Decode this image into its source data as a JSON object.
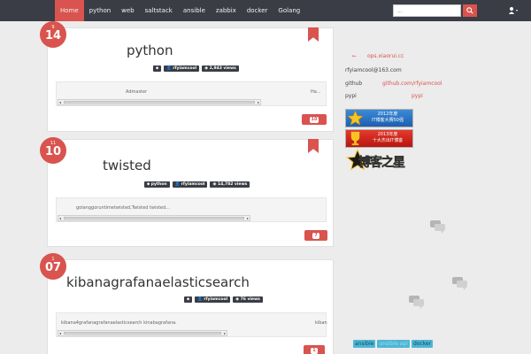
{
  "nav": {
    "items": [
      "Home",
      "python",
      "web",
      "saltstack",
      "ansible",
      "zabbix",
      "docker",
      "Golang"
    ],
    "active": "Home"
  },
  "search": {
    "placeholder": "..."
  },
  "posts": [
    {
      "month": "9",
      "day": "14",
      "title": "python",
      "tags": [
        "",
        "rfyiamcool",
        "2,943 views"
      ],
      "excerpt_left": "Admaster",
      "excerpt_right": "Ha...",
      "comments": "10"
    },
    {
      "month": "11",
      "day": "10",
      "title": "twisted",
      "tags": [
        "python",
        "rfyiamcool",
        "14,782 views"
      ],
      "excerpt_left": "golanggoruntimetwisted,Twisted twisted...",
      "excerpt_right": "",
      "comments": "7"
    },
    {
      "month": "1",
      "day": "07",
      "title": "kibanagrafanaelasticsearch",
      "tags": [
        "",
        "rfyiamcool",
        "76 views"
      ],
      "excerpt_left": "kibana4grafanagrafanaelasticsearch kinabagrafana.",
      "excerpt_right": "kiban",
      "comments": "1"
    }
  ],
  "sidebar": {
    "site_arrow": "←",
    "site": "ops.xiaorui.cc",
    "email": "rfyiamcool@163.com",
    "github_label": "github",
    "github_value": "github.com/rfyiamcool",
    "pypi_label": "pypi",
    "pypi_value": "pypi",
    "award1": [
      "2012年度",
      "IT博客大赛50强"
    ],
    "award2": [
      "2013年度",
      "十大杰出IT博客"
    ],
    "logo_text": "博客之星"
  },
  "tag_cloud": [
    "ansible",
    "ansible api",
    "docker"
  ],
  "colors": {
    "accent": "#d9534f",
    "nav_bg": "#3a3d45",
    "tag_cloud": "#4db6d6"
  }
}
